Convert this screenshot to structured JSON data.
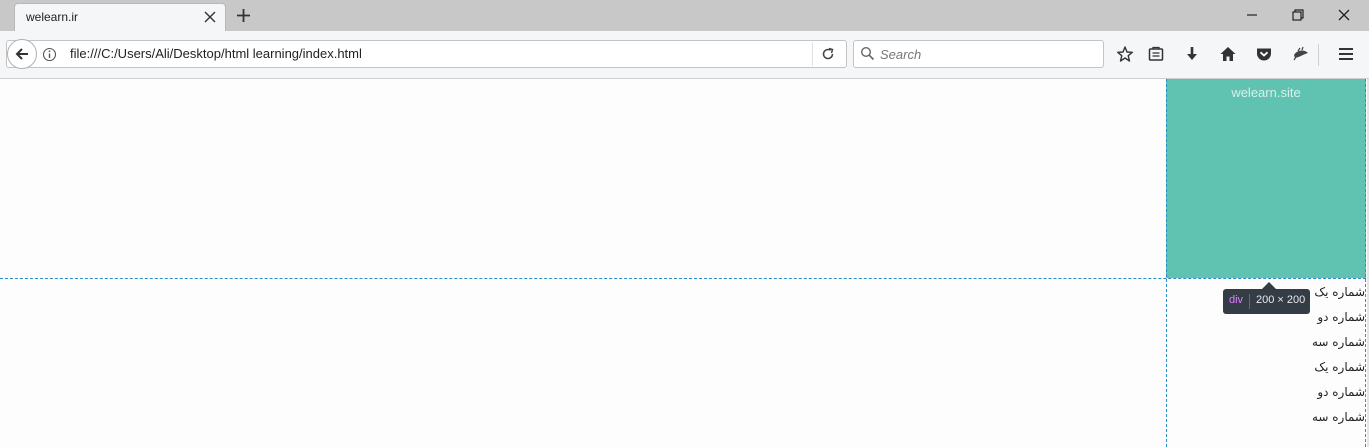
{
  "browser": {
    "tab": {
      "title": "welearn.ir"
    },
    "url": "file:///C:/Users/Ali/Desktop/html learning/index.html",
    "search": {
      "placeholder": "Search"
    }
  },
  "page": {
    "box_text": "welearn.site",
    "box_color": "#60c3b2",
    "list_items": [
      "شماره یک",
      "شماره دو",
      "شماره سه",
      "شماره یک",
      "شماره دو",
      "شماره سه"
    ]
  },
  "inspector": {
    "tag": "div",
    "dimensions": "200 × 200"
  },
  "icons": {
    "tab_close": "close-icon",
    "new_tab": "plus-icon",
    "back": "arrow-left-icon",
    "info": "info-icon",
    "reload": "reload-icon",
    "search": "search-icon",
    "toolbar": [
      "star-icon",
      "reading-list-icon",
      "download-icon",
      "home-icon",
      "pocket-icon",
      "extension-icon",
      "menu-icon"
    ],
    "window": [
      "minimize-icon",
      "restore-icon",
      "close-window-icon"
    ]
  }
}
